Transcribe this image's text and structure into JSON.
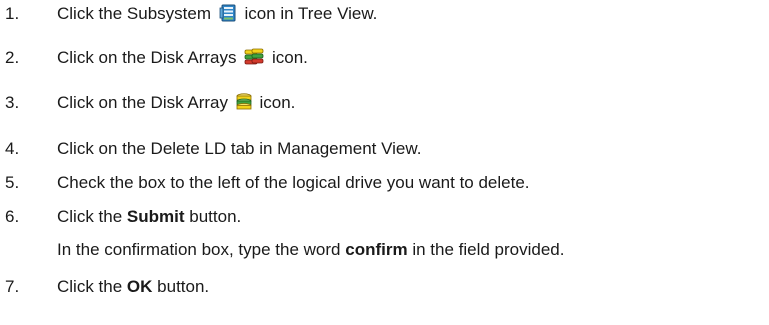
{
  "steps": [
    {
      "number": "1.",
      "before": "Click the Subsystem",
      "icon": "subsystem-icon",
      "after": "icon in Tree View."
    },
    {
      "number": "2.",
      "before": "Click on the Disk Arrays",
      "icon": "disk-arrays-icon",
      "after": "icon."
    },
    {
      "number": "3.",
      "before": "Click on the Disk Array",
      "icon": "disk-array-icon",
      "after": "icon."
    },
    {
      "number": "4.",
      "text": "Click on the Delete LD tab in Management View."
    },
    {
      "number": "5.",
      "text": "Check the box to the left of the logical drive you want to delete."
    },
    {
      "number": "6.",
      "before": "Click the",
      "bold": "Submit",
      "after": "button."
    },
    {
      "note_before": "In the confirmation box, type the word",
      "note_bold": "confirm",
      "note_after": "in the field provided."
    },
    {
      "number": "7.",
      "before": "Click the",
      "bold": "OK",
      "after": "button."
    }
  ],
  "colors": {
    "text": "#1a1a1a",
    "subsystem_icon": "#2f86c8",
    "disk_icon_yellow": "#f2d21a",
    "disk_icon_green": "#3fa33f",
    "disk_icon_red": "#d33a2c"
  }
}
